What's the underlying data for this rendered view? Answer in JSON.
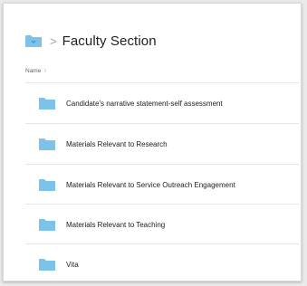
{
  "breadcrumb": {
    "separator": ">",
    "title": "Faculty Section"
  },
  "list": {
    "sort_column": "Name",
    "sort_arrow": "↑",
    "items": [
      {
        "label": "Candidate's narrative statement-self assessment",
        "icon": "folder-icon"
      },
      {
        "label": "Materials Relevant to Research",
        "icon": "folder-icon"
      },
      {
        "label": "Materials Relevant to Service Outreach Engagement",
        "icon": "folder-icon"
      },
      {
        "label": "Materials Relevant to Teaching",
        "icon": "folder-icon"
      },
      {
        "label": "Vita",
        "icon": "folder-icon"
      }
    ]
  },
  "colors": {
    "folder": "#7cc3ea",
    "folder_tab": "#5fb2e2"
  }
}
